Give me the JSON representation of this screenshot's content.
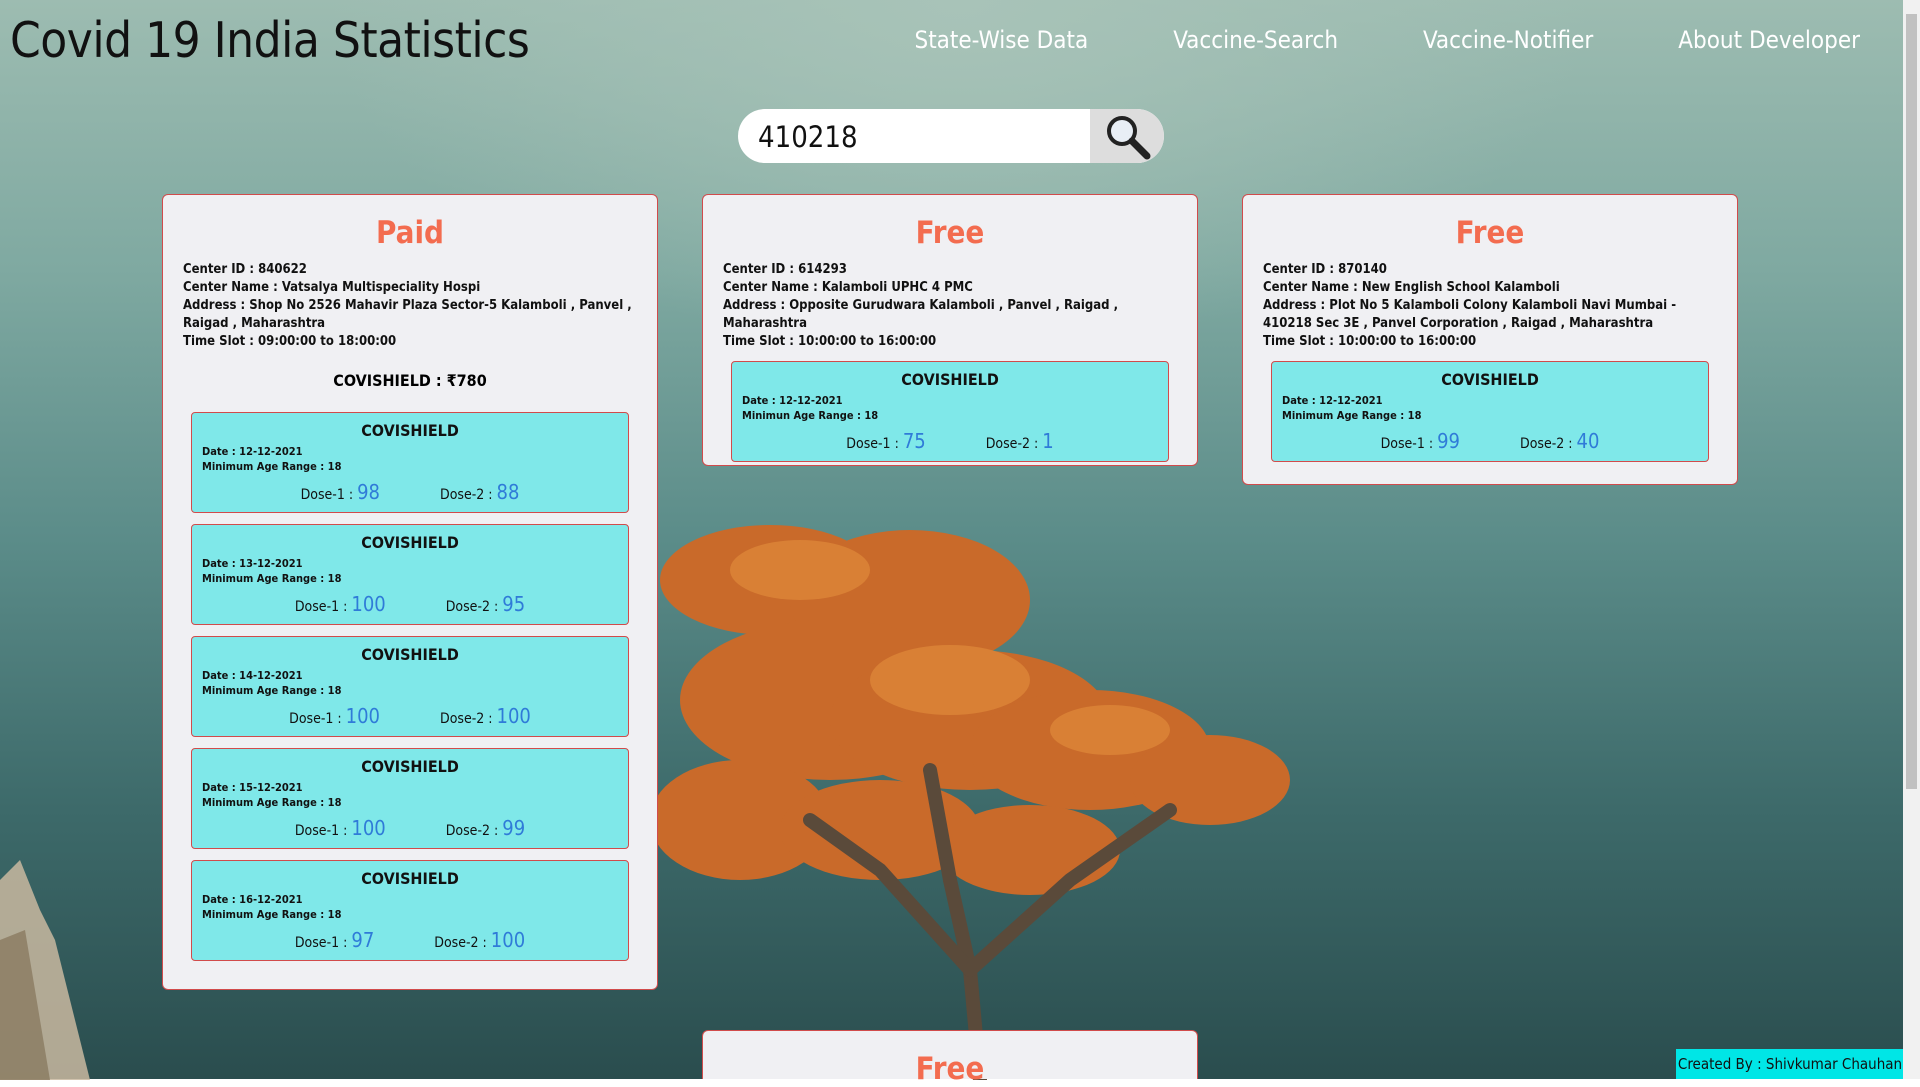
{
  "header": {
    "title": "Covid 19 India Statistics",
    "nav": [
      "State-Wise Data",
      "Vaccine-Search",
      "Vaccine-Notifier",
      "About Developer"
    ]
  },
  "search": {
    "value": "410218"
  },
  "cards": [
    {
      "fee_type": "Paid",
      "center_id": "Center ID : 840622",
      "center_name": "Center Name : Vatsalya Multispeciality Hospi",
      "address": "Address : Shop No 2526 Mahavir Plaza Sector-5 Kalamboli , Panvel , Raigad , Maharashtra",
      "time_slot": "Time Slot : 09:00:00 to 18:00:00",
      "price": "COVISHIELD : ₹780",
      "sessions": [
        {
          "vaccine": "COVISHIELD",
          "date": "Date : 12-12-2021",
          "age": "Minimum Age Range : 18",
          "dose1_label": "Dose-1 :",
          "dose1": "98",
          "dose2_label": "Dose-2 :",
          "dose2": "88"
        },
        {
          "vaccine": "COVISHIELD",
          "date": "Date : 13-12-2021",
          "age": "Minimum Age Range : 18",
          "dose1_label": "Dose-1 :",
          "dose1": "100",
          "dose2_label": "Dose-2 :",
          "dose2": "95"
        },
        {
          "vaccine": "COVISHIELD",
          "date": "Date : 14-12-2021",
          "age": "Minimum Age Range : 18",
          "dose1_label": "Dose-1 :",
          "dose1": "100",
          "dose2_label": "Dose-2 :",
          "dose2": "100"
        },
        {
          "vaccine": "COVISHIELD",
          "date": "Date : 15-12-2021",
          "age": "Minimum Age Range : 18",
          "dose1_label": "Dose-1 :",
          "dose1": "100",
          "dose2_label": "Dose-2 :",
          "dose2": "99"
        },
        {
          "vaccine": "COVISHIELD",
          "date": "Date : 16-12-2021",
          "age": "Minimum Age Range : 18",
          "dose1_label": "Dose-1 :",
          "dose1": "97",
          "dose2_label": "Dose-2 :",
          "dose2": "100"
        }
      ]
    },
    {
      "fee_type": "Free",
      "center_id": "Center ID : 614293",
      "center_name": "Center Name : Kalamboli UPHC 4 PMC",
      "address": "Address : Opposite Gurudwara Kalamboli , Panvel , Raigad , Maharashtra",
      "time_slot": "Time Slot : 10:00:00 to 16:00:00",
      "sessions": [
        {
          "vaccine": "COVISHIELD",
          "date": "Date : 12-12-2021",
          "age": "Minimun Age Range : 18",
          "dose1_label": "Dose-1 :",
          "dose1": "75",
          "dose2_label": "Dose-2 :",
          "dose2": "1"
        }
      ]
    },
    {
      "fee_type": "Free",
      "center_id": "Center ID : 870140",
      "center_name": "Center Name : New English School Kalamboli",
      "address": "Address : Plot No 5 Kalamboli Colony Kalamboli Navi Mumbai - 410218 Sec 3E , Panvel Corporation , Raigad , Maharashtra",
      "time_slot": "Time Slot : 10:00:00 to 16:00:00",
      "sessions": [
        {
          "vaccine": "COVISHIELD",
          "date": "Date : 12-12-2021",
          "age": "Minimum Age Range : 18",
          "dose1_label": "Dose-1 :",
          "dose1": "99",
          "dose2_label": "Dose-2 :",
          "dose2": "40"
        }
      ]
    },
    {
      "fee_type": "Free"
    }
  ],
  "footer": {
    "credit": "Created By : Shivkumar Chauhan"
  }
}
